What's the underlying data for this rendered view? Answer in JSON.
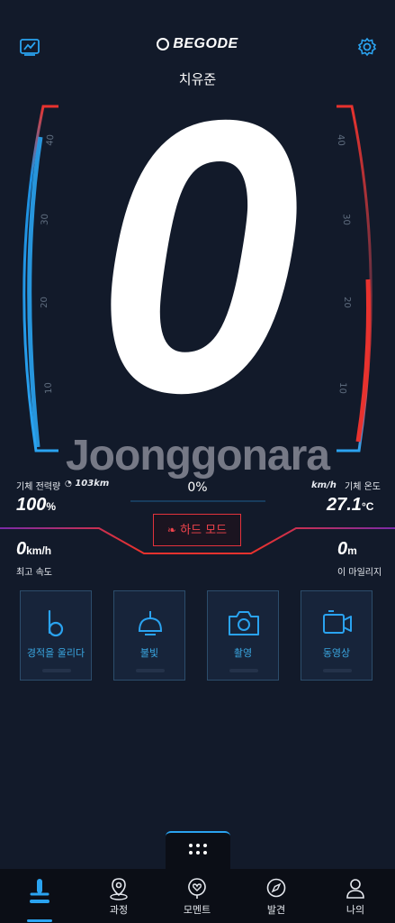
{
  "header": {
    "brand": "BEGODE",
    "username": "치유준",
    "left_icon": "chart-icon",
    "right_icon": "gear-icon"
  },
  "speed": {
    "value": "0",
    "scale_left": [
      "40",
      "30",
      "20",
      "10"
    ],
    "scale_right": [
      "40",
      "30",
      "20",
      "10"
    ]
  },
  "watermark": "Joonggonara",
  "stats": {
    "battery_label": "기체 전력량",
    "range": "103km",
    "battery_value": "100",
    "battery_unit": "%",
    "center_percent": "0%",
    "temp_label": "기체 온도",
    "speed_unit": "km/h",
    "temp_value": "27.1",
    "temp_unit": "°C",
    "max_speed_value": "0",
    "max_speed_unit": "km/h",
    "max_speed_label": "최고 속도",
    "mileage_value": "0",
    "mileage_unit": "m",
    "mileage_label": "이 마일리지"
  },
  "mode_button": {
    "label": "하드 모드",
    "icon": "leaf-icon"
  },
  "cards": [
    {
      "label": "경적을 울리다",
      "icon": "horn-icon"
    },
    {
      "label": "불빛",
      "icon": "lamp-icon"
    },
    {
      "label": "촬영",
      "icon": "camera-icon"
    },
    {
      "label": "동영상",
      "icon": "video-camera-icon"
    }
  ],
  "more_icon": "dots-grid-icon",
  "nav": [
    {
      "label": "",
      "icon": "scooter-icon",
      "active": true
    },
    {
      "label": "과정",
      "icon": "map-pin-icon"
    },
    {
      "label": "모멘트",
      "icon": "heart-pin-icon"
    },
    {
      "label": "발견",
      "icon": "compass-icon"
    },
    {
      "label": "나의",
      "icon": "user-icon"
    }
  ],
  "colors": {
    "background": "#121a2a",
    "accent_blue": "#2aa3f0",
    "accent_red": "#e8322e"
  }
}
